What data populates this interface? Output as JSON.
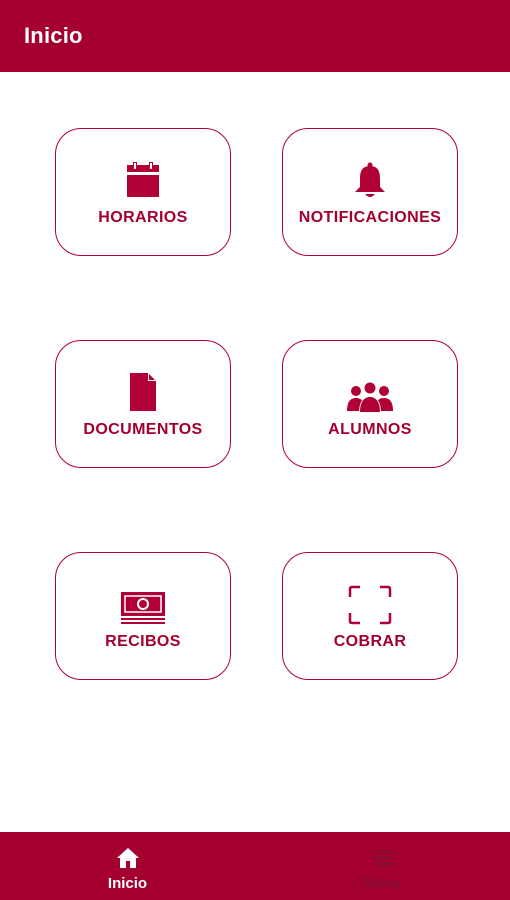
{
  "header": {
    "title": "Inicio"
  },
  "tiles": [
    {
      "label": "HORARIOS",
      "icon": "calendar-icon"
    },
    {
      "label": "NOTIFICACIONES",
      "icon": "bell-icon"
    },
    {
      "label": "DOCUMENTOS",
      "icon": "document-icon"
    },
    {
      "label": "ALUMNOS",
      "icon": "group-icon"
    },
    {
      "label": "RECIBOS",
      "icon": "money-icon"
    },
    {
      "label": "COBRAR",
      "icon": "scan-frame-icon"
    }
  ],
  "bottom_nav": [
    {
      "label": "Inicio",
      "icon": "home-icon",
      "active": true
    },
    {
      "label": "Menu",
      "icon": "menu-icon",
      "active": false
    }
  ],
  "colors": {
    "primary": "#a4002f",
    "background": "#ffffff"
  }
}
